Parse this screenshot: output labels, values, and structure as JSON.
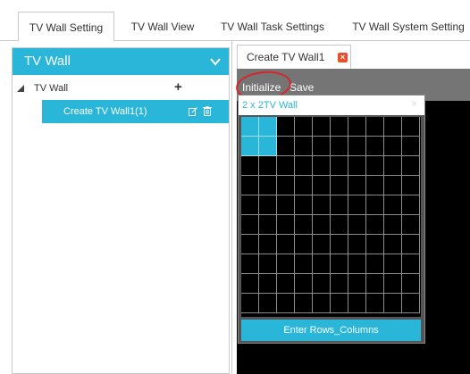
{
  "top_tabs": [
    {
      "label": "TV Wall Setting",
      "active": true
    },
    {
      "label": "TV Wall View",
      "active": false
    },
    {
      "label": "TV Wall Task Settings",
      "active": false
    },
    {
      "label": "TV Wall System Setting",
      "active": false
    }
  ],
  "sidebar": {
    "title": "TV Wall",
    "tree_root_label": "TV Wall",
    "add_symbol": "+",
    "items": [
      {
        "label": "Create TV Wall1(1)"
      }
    ]
  },
  "editor": {
    "tab_label": "Create TV Wall1",
    "close_symbol": "×",
    "toolbar": {
      "initialize_label": "Initialize",
      "save_label": "Save"
    }
  },
  "popup": {
    "title": "2 x 2TV Wall",
    "close_symbol": "×",
    "rows": 10,
    "columns": 10,
    "selected_rows": 2,
    "selected_columns": 2,
    "button_label": "Enter Rows_Columns"
  },
  "colors": {
    "accent": "#29b6d8",
    "toolbar": "#757575",
    "close_badge": "#e8502c",
    "highlight_circle": "#d7262a",
    "screen": "#000000"
  },
  "icons": {
    "collapse": "chevron-down-icon",
    "tree_toggle": "triangle-down-icon",
    "edit": "edit-icon",
    "delete": "trash-icon"
  }
}
